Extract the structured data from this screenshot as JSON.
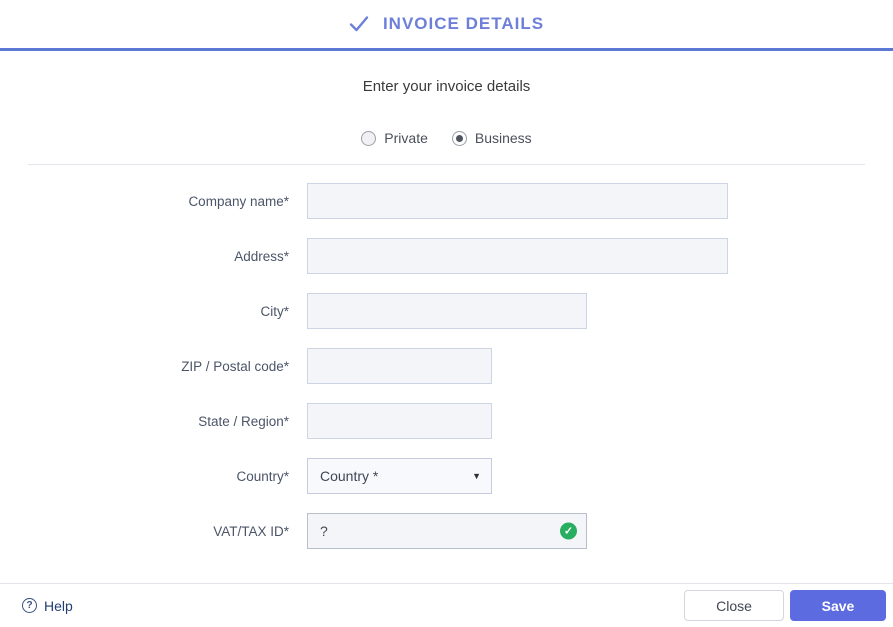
{
  "header": {
    "title": "INVOICE DETAILS"
  },
  "form": {
    "heading": "Enter your invoice details",
    "type_options": [
      {
        "label": "Private",
        "selected": false
      },
      {
        "label": "Business",
        "selected": true
      }
    ],
    "fields": [
      {
        "label": "Company name*",
        "value": "",
        "type": "text",
        "size": "large"
      },
      {
        "label": "Address*",
        "value": "",
        "type": "text",
        "size": "large"
      },
      {
        "label": "City*",
        "value": "",
        "type": "text",
        "size": "medium"
      },
      {
        "label": "ZIP / Postal code*",
        "value": "",
        "type": "text",
        "size": "small"
      },
      {
        "label": "State / Region*",
        "value": "",
        "type": "text",
        "size": "small"
      },
      {
        "label": "Country*",
        "value": "Country *",
        "type": "select",
        "size": "small"
      },
      {
        "label": "VAT/TAX ID*",
        "value": "?",
        "type": "text",
        "size": "medium",
        "valid": true
      }
    ]
  },
  "footer": {
    "help_label": "Help",
    "close_label": "Close",
    "save_label": "Save"
  },
  "icons": {
    "header_check": "check",
    "select_arrow": "▼",
    "valid_check": "✓",
    "help_glyph": "?"
  },
  "colors": {
    "accent_blue": "#5c6be0",
    "header_text": "#6d7fd9",
    "header_border": "#5b78d4",
    "valid_green": "#27ae60",
    "input_bg": "#f4f5f9",
    "input_border": "#cdd4e4"
  }
}
